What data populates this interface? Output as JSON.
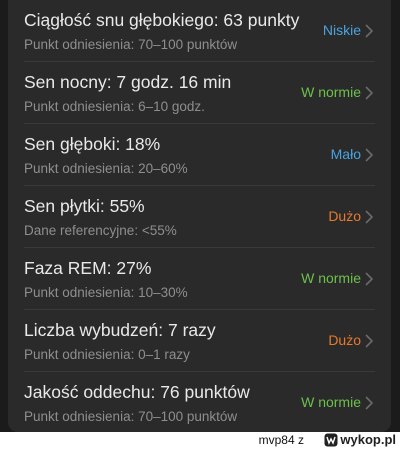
{
  "rows": [
    {
      "title": "Ciągłość snu głębokiego: 63 punkty",
      "ref": "Punkt odniesienia: 70–100 punktów",
      "status": "Niskie",
      "status_color": "#4aa3df"
    },
    {
      "title": "Sen nocny: 7 godz. 16 min",
      "ref": "Punkt odniesienia: 6–10 godz.",
      "status": "W normie",
      "status_color": "#6cc04a"
    },
    {
      "title": "Sen głęboki: 18%",
      "ref": "Punkt odniesienia: 20–60%",
      "status": "Mało",
      "status_color": "#4aa3df"
    },
    {
      "title": "Sen płytki: 55%",
      "ref": "Dane referencyjne: <55%",
      "status": "Dużo",
      "status_color": "#e8792f"
    },
    {
      "title": "Faza REM: 27%",
      "ref": "Punkt odniesienia: 10–30%",
      "status": "W normie",
      "status_color": "#6cc04a"
    },
    {
      "title": "Liczba wybudzeń: 7 razy",
      "ref": "Punkt odniesienia: 0–1 razy",
      "status": "Dużo",
      "status_color": "#e8792f"
    },
    {
      "title": "Jakość oddechu: 76 punktów",
      "ref": "Punkt odniesienia: 70–100 punktów",
      "status": "W normie",
      "status_color": "#6cc04a"
    }
  ],
  "chevron_icon": "chevron-right-icon",
  "footer": {
    "user": "mvp84",
    "separator": "z",
    "site": "wykop.pl"
  }
}
